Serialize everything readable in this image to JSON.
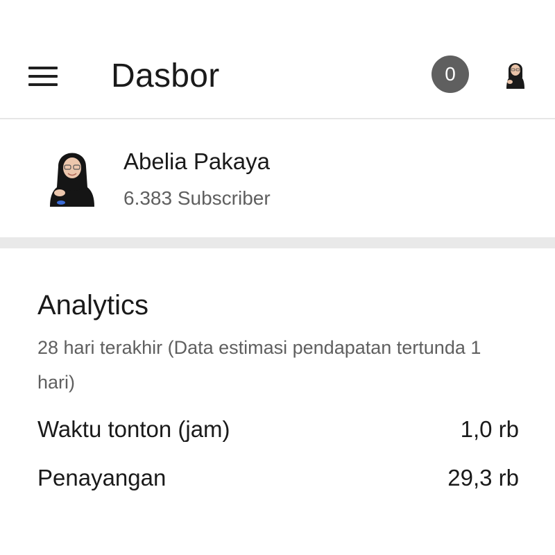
{
  "header": {
    "menu_icon": "hamburger-menu-icon",
    "title": "Dasbor",
    "notification_count": "0",
    "account_avatar": "user-avatar"
  },
  "channel": {
    "name": "Abelia Pakaya",
    "subscribers": "6.383 Subscriber"
  },
  "analytics": {
    "title": "Analytics",
    "subtitle": "28 hari terakhir (Data estimasi pendapatan tertunda 1 hari)",
    "metrics": [
      {
        "label": "Waktu tonton (jam)",
        "value": "1,0 rb"
      },
      {
        "label": "Penayangan",
        "value": "29,3 rb"
      }
    ]
  },
  "colors": {
    "badge_bg": "#5f5f5f",
    "text_primary": "#1a1a1a",
    "text_secondary": "#5f5f5f",
    "divider": "#e9e9e9"
  }
}
